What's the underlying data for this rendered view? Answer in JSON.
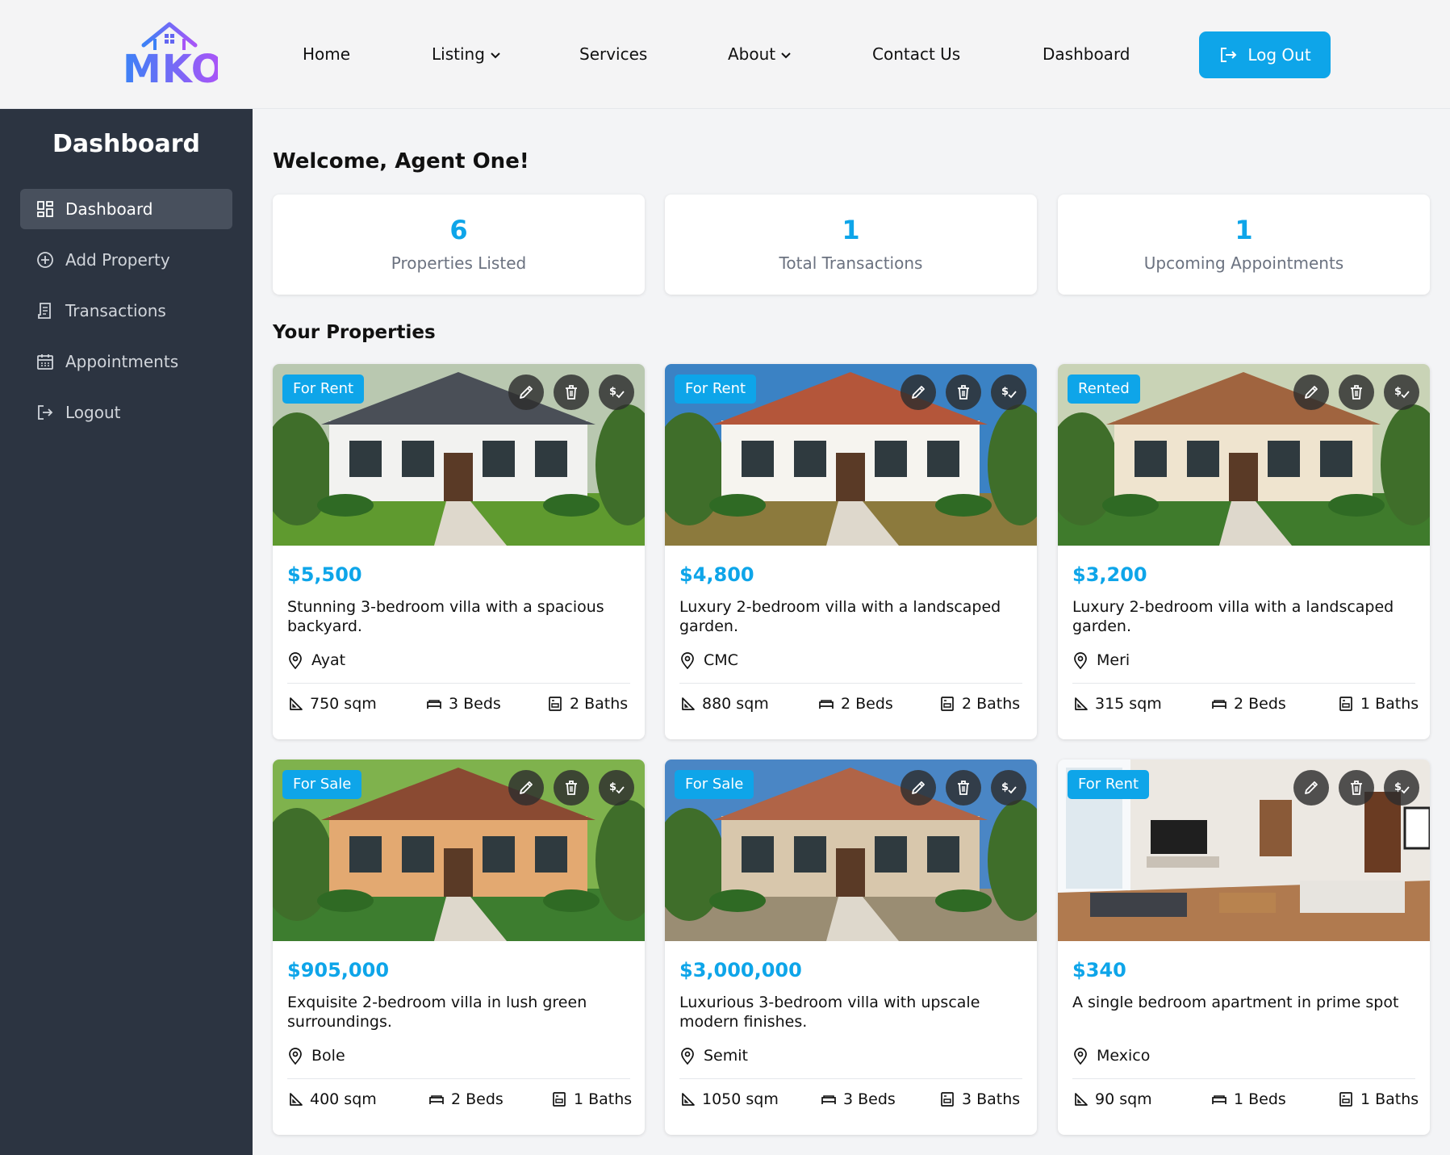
{
  "brand": {
    "logo_text": "MKO"
  },
  "nav": {
    "items": [
      {
        "label": "Home"
      },
      {
        "label": "Listing"
      },
      {
        "label": "Services"
      },
      {
        "label": "About"
      },
      {
        "label": "Contact Us"
      },
      {
        "label": "Dashboard"
      }
    ],
    "logout_label": "Log Out"
  },
  "sidebar": {
    "title": "Dashboard",
    "items": [
      {
        "label": "Dashboard",
        "icon": "grid-icon",
        "active": true
      },
      {
        "label": "Add Property",
        "icon": "plus-circle-icon"
      },
      {
        "label": "Transactions",
        "icon": "receipt-icon"
      },
      {
        "label": "Appointments",
        "icon": "calendar-icon"
      },
      {
        "label": "Logout",
        "icon": "logout-icon"
      }
    ]
  },
  "main": {
    "welcome": "Welcome, Agent One!",
    "stats": [
      {
        "value": "6",
        "label": "Properties Listed"
      },
      {
        "value": "1",
        "label": "Total Transactions"
      },
      {
        "value": "1",
        "label": "Upcoming Appointments"
      }
    ],
    "section_title": "Your Properties"
  },
  "properties": [
    {
      "status": "For Rent",
      "price": "$5,500",
      "description": "Stunning 3-bedroom villa with a spacious backyard.",
      "location": "Ayat",
      "area": "750 sqm",
      "beds": "3 Beds",
      "baths": "2 Baths"
    },
    {
      "status": "For Rent",
      "price": "$4,800",
      "description": "Luxury 2-bedroom villa with a landscaped garden.",
      "location": "CMC",
      "area": "880 sqm",
      "beds": "2 Beds",
      "baths": "2 Baths"
    },
    {
      "status": "Rented",
      "price": "$3,200",
      "description": "Luxury 2-bedroom villa with a landscaped garden.",
      "location": "Meri",
      "area": "315 sqm",
      "beds": "2 Beds",
      "baths": "1 Baths"
    },
    {
      "status": "For Sale",
      "price": "$905,000",
      "description": "Exquisite 2-bedroom villa in lush green surroundings.",
      "location": "Bole",
      "area": "400 sqm",
      "beds": "2 Beds",
      "baths": "1 Baths"
    },
    {
      "status": "For Sale",
      "price": "$3,000,000",
      "description": "Luxurious 3-bedroom villa with upscale modern finishes.",
      "location": "Semit",
      "area": "1050 sqm",
      "beds": "3 Beds",
      "baths": "3 Baths"
    },
    {
      "status": "For Rent",
      "price": "$340",
      "description": "A single bedroom apartment in prime spot",
      "location": "Mexico",
      "area": "90 sqm",
      "beds": "1 Beds",
      "baths": "1 Baths"
    }
  ],
  "colors": {
    "accent": "#0ea5e9",
    "sidebar_bg": "#2c3441",
    "sidebar_active": "#48505d"
  }
}
